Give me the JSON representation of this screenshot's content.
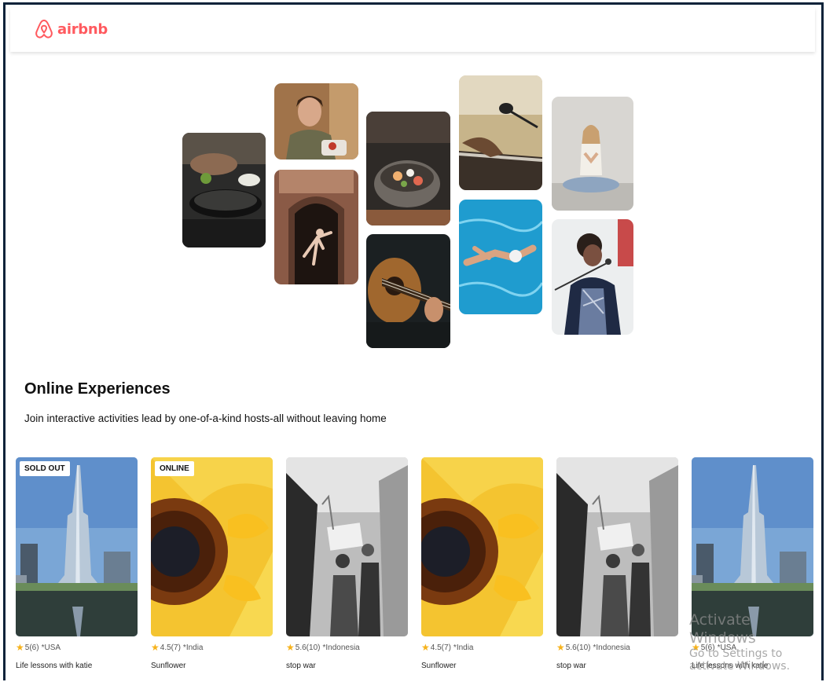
{
  "header": {
    "brand": "airbnb"
  },
  "hero": {
    "tiles": [
      "cooking-photo",
      "woman-smiling-photo",
      "dancer-arch-photo",
      "food-bowl-photo",
      "guitar-photo",
      "microphone-photo",
      "swimmer-photo",
      "yoga-photo",
      "singer-photo"
    ]
  },
  "section": {
    "title": "Online Experiences",
    "subtitle": "Join interactive activities lead by one-of-a-kind hosts-all without leaving home"
  },
  "cards": [
    {
      "badge": "SOLD OUT",
      "rating": "5",
      "reviews": "(6)",
      "location": "USA",
      "title": "Life lessons with katie",
      "image": "burj-khalifa-photo"
    },
    {
      "badge": "ONLINE",
      "rating": "4.5",
      "reviews": "(7)",
      "location": "India",
      "title": "Sunflower",
      "image": "sunflower-photo"
    },
    {
      "badge": "",
      "rating": "5.6",
      "reviews": "(10)",
      "location": "Indonesia",
      "title": "stop war",
      "image": "protest-photo"
    },
    {
      "badge": "",
      "rating": "4.5",
      "reviews": "(7)",
      "location": "India",
      "title": "Sunflower",
      "image": "sunflower-photo"
    },
    {
      "badge": "",
      "rating": "5.6",
      "reviews": "(10)",
      "location": "Indonesia",
      "title": "stop war",
      "image": "protest-photo"
    },
    {
      "badge": "",
      "rating": "5",
      "reviews": "(6)",
      "location": "USA",
      "title": "Life lessons with katie",
      "image": "burj-khalifa-photo"
    }
  ],
  "rating_prefix": "*",
  "watermark": {
    "line1": "Activate Windows",
    "line2": "Go to Settings to activate Windows."
  },
  "colors": {
    "brand": "#ff5a5f",
    "star": "#f6b21b",
    "frame_border": "#0b2239"
  }
}
